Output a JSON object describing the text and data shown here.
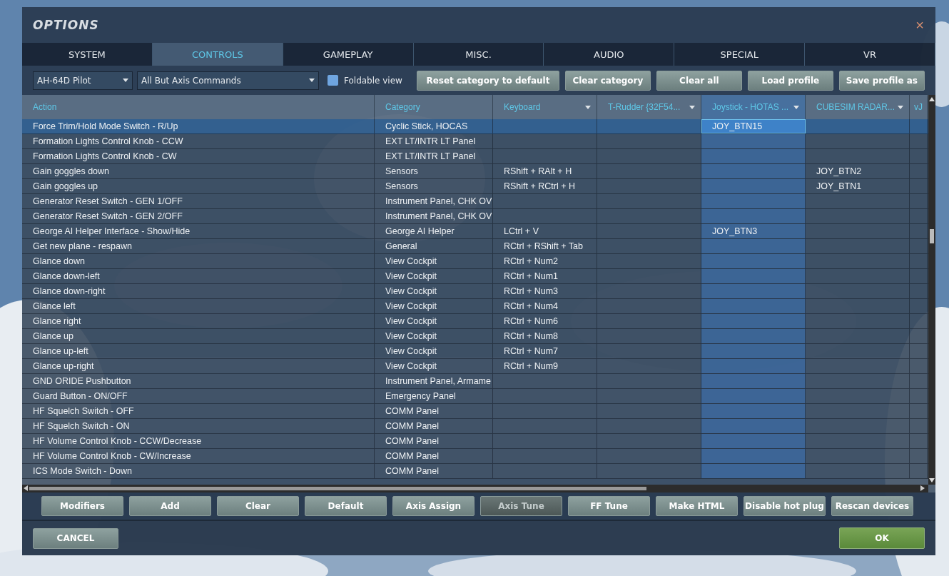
{
  "window": {
    "title": "OPTIONS",
    "close": "×"
  },
  "tabs": [
    {
      "label": "SYSTEM",
      "selected": false
    },
    {
      "label": "CONTROLS",
      "selected": true
    },
    {
      "label": "GAMEPLAY",
      "selected": false
    },
    {
      "label": "MISC.",
      "selected": false
    },
    {
      "label": "AUDIO",
      "selected": false
    },
    {
      "label": "SPECIAL",
      "selected": false
    },
    {
      "label": "VR",
      "selected": false
    }
  ],
  "toolbar": {
    "aircraft": "AH-64D Pilot",
    "filter": "All But Axis Commands",
    "foldable_view": {
      "label": "Foldable view",
      "checked": false
    },
    "buttons": [
      "Reset category to default",
      "Clear category",
      "Clear all",
      "Load profile",
      "Save profile as"
    ]
  },
  "table": {
    "columns": [
      {
        "label": "Action",
        "dropdown": false,
        "selected": false
      },
      {
        "label": "Category",
        "dropdown": false,
        "selected": false
      },
      {
        "label": "Keyboard",
        "dropdown": true,
        "selected": false
      },
      {
        "label": "T-Rudder {32F54...",
        "dropdown": true,
        "selected": false
      },
      {
        "label": "Joystick - HOTAS ...",
        "dropdown": true,
        "selected": true
      },
      {
        "label": "CUBESIM RADAR...",
        "dropdown": true,
        "selected": false
      },
      {
        "label": "vJ",
        "selected": false
      }
    ],
    "rows": [
      {
        "action": "Force Trim/Hold Mode Switch - R/Up",
        "category": "Cyclic Stick, HOCAS",
        "joystick": "JOY_BTN15",
        "selected": true
      },
      {
        "action": "Formation Lights Control Knob - CCW",
        "category": "EXT LT/INTR LT Panel",
        "selected": false
      },
      {
        "action": "Formation Lights Control Knob - CW",
        "category": "EXT LT/INTR LT Panel",
        "selected": false
      },
      {
        "action": "Gain goggles down",
        "category": "Sensors",
        "keyboard": "RShift + RAlt + H",
        "cubesim": "JOY_BTN2",
        "selected": false
      },
      {
        "action": "Gain goggles up",
        "category": "Sensors",
        "keyboard": "RShift + RCtrl + H",
        "cubesim": "JOY_BTN1",
        "selected": false
      },
      {
        "action": "Generator Reset Switch - GEN 1/OFF",
        "category": "Instrument Panel, CHK OV",
        "selected": false
      },
      {
        "action": "Generator Reset Switch - GEN 2/OFF",
        "category": "Instrument Panel, CHK OV",
        "selected": false
      },
      {
        "action": "George AI Helper Interface - Show/Hide",
        "category": "George AI Helper",
        "keyboard": "LCtrl + V",
        "joystick": "JOY_BTN3",
        "selected": false
      },
      {
        "action": "Get new plane - respawn",
        "category": "General",
        "keyboard": "RCtrl + RShift + Tab",
        "selected": false
      },
      {
        "action": "Glance down",
        "category": "View Cockpit",
        "keyboard": "RCtrl + Num2",
        "selected": false
      },
      {
        "action": "Glance down-left",
        "category": "View Cockpit",
        "keyboard": "RCtrl + Num1",
        "selected": false
      },
      {
        "action": "Glance down-right",
        "category": "View Cockpit",
        "keyboard": "RCtrl + Num3",
        "selected": false
      },
      {
        "action": "Glance left",
        "category": "View Cockpit",
        "keyboard": "RCtrl + Num4",
        "selected": false
      },
      {
        "action": "Glance right",
        "category": "View Cockpit",
        "keyboard": "RCtrl + Num6",
        "selected": false
      },
      {
        "action": "Glance up",
        "category": "View Cockpit",
        "keyboard": "RCtrl + Num8",
        "selected": false
      },
      {
        "action": "Glance up-left",
        "category": "View Cockpit",
        "keyboard": "RCtrl + Num7",
        "selected": false
      },
      {
        "action": "Glance up-right",
        "category": "View Cockpit",
        "keyboard": "RCtrl + Num9",
        "selected": false
      },
      {
        "action": "GND ORIDE Pushbutton",
        "category": "Instrument Panel, Armame",
        "selected": false
      },
      {
        "action": "Guard Button - ON/OFF",
        "category": "Emergency Panel",
        "selected": false
      },
      {
        "action": "HF Squelch Switch - OFF",
        "category": "COMM Panel",
        "selected": false
      },
      {
        "action": "HF Squelch Switch - ON",
        "category": "COMM Panel",
        "selected": false
      },
      {
        "action": "HF Volume Control Knob - CCW/Decrease",
        "category": "COMM Panel",
        "selected": false
      },
      {
        "action": "HF Volume Control Knob - CW/Increase",
        "category": "COMM Panel",
        "selected": false
      },
      {
        "action": "ICS Mode Switch - Down",
        "category": "COMM Panel",
        "selected": false
      }
    ]
  },
  "actions": [
    {
      "label": "Modifiers",
      "disabled": false
    },
    {
      "label": "Add",
      "disabled": false
    },
    {
      "label": "Clear",
      "disabled": false
    },
    {
      "label": "Default",
      "disabled": false
    },
    {
      "label": "Axis Assign",
      "disabled": false
    },
    {
      "label": "Axis Tune",
      "disabled": true
    },
    {
      "label": "FF Tune",
      "disabled": false
    },
    {
      "label": "Make HTML",
      "disabled": false
    },
    {
      "label": "Disable hot plug",
      "disabled": false
    },
    {
      "label": "Rescan devices",
      "disabled": false
    }
  ],
  "footer": {
    "cancel": "CANCEL",
    "ok": "OK"
  }
}
